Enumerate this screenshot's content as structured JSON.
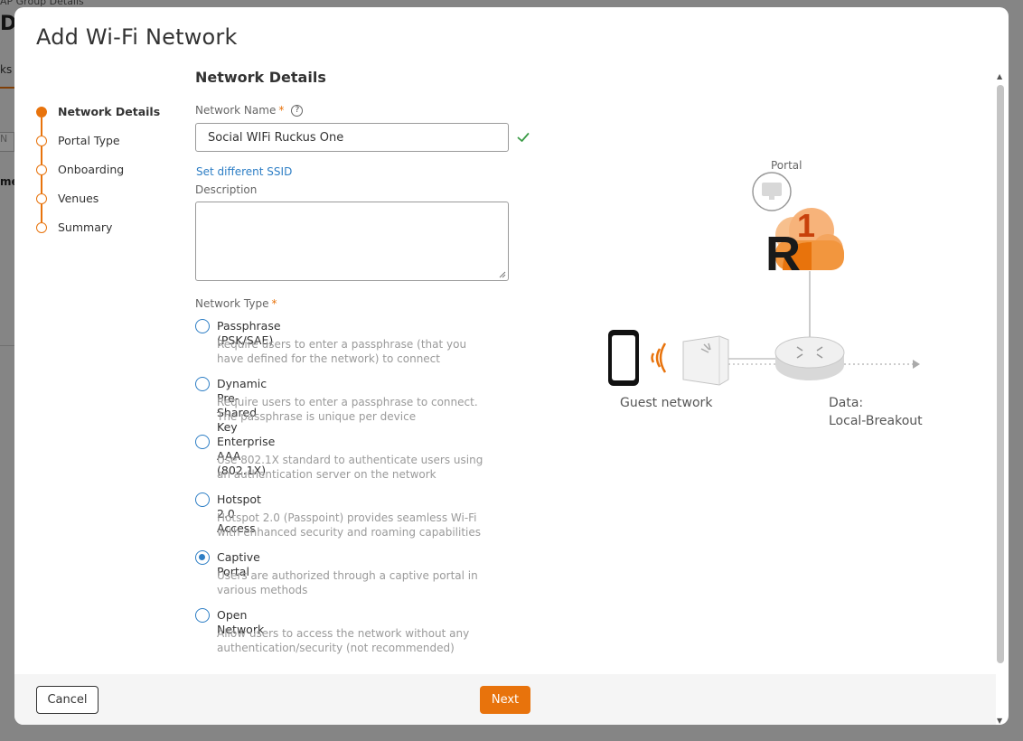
{
  "background": {
    "breadcrumb": "AP Group Details",
    "big_glyph": "D",
    "tab_fragment": "ks",
    "input_fragment": "N",
    "name_fragment": "me"
  },
  "modal": {
    "title": "Add Wi-Fi Network"
  },
  "stepper": {
    "steps": [
      {
        "label": "Network Details",
        "active": true
      },
      {
        "label": "Portal Type",
        "active": false
      },
      {
        "label": "Onboarding",
        "active": false
      },
      {
        "label": "Venues",
        "active": false
      },
      {
        "label": "Summary",
        "active": false
      }
    ]
  },
  "form": {
    "section_title": "Network Details",
    "network_name_label": "Network Name",
    "required_mark": "*",
    "help_glyph": "?",
    "network_name_value": "Social WIFi Ruckus One",
    "set_ssid_link": "Set different SSID",
    "description_label": "Description",
    "description_value": "",
    "network_type_label": "Network Type",
    "network_types": [
      {
        "title": "Passphrase (PSK/SAE)",
        "desc": "Require users to enter a passphrase (that you have defined for the network) to connect",
        "selected": false
      },
      {
        "title": "Dynamic Pre-Shared Key",
        "desc": "Require users to enter a passphrase to connect. The passphrase is unique per device",
        "selected": false
      },
      {
        "title": "Enterprise AAA (802.1X)",
        "desc": "Use 802.1X standard to authenticate users using an authentication server on the network",
        "selected": false
      },
      {
        "title": "Hotspot 2.0 Access",
        "desc": "Hotspot 2.0 (Passpoint) provides seamless Wi-Fi with enhanced security and roaming capabilities",
        "selected": false
      },
      {
        "title": "Captive Portal",
        "desc": "Users are authorized through a captive portal in various methods",
        "selected": true
      },
      {
        "title": "Open Network",
        "desc": "Allow users to access the network without any authentication/security (not recommended)",
        "selected": false
      }
    ]
  },
  "diagram": {
    "portal_label": "Portal",
    "logo_letter": "R",
    "logo_digit": "1",
    "guest_label": "Guest network",
    "data_label": "Data:",
    "data_value": "Local-Breakout"
  },
  "footer": {
    "cancel_label": "Cancel",
    "next_label": "Next"
  },
  "colors": {
    "accent": "#e8730c",
    "link": "#2d7ec5",
    "success": "#3a9b46"
  }
}
